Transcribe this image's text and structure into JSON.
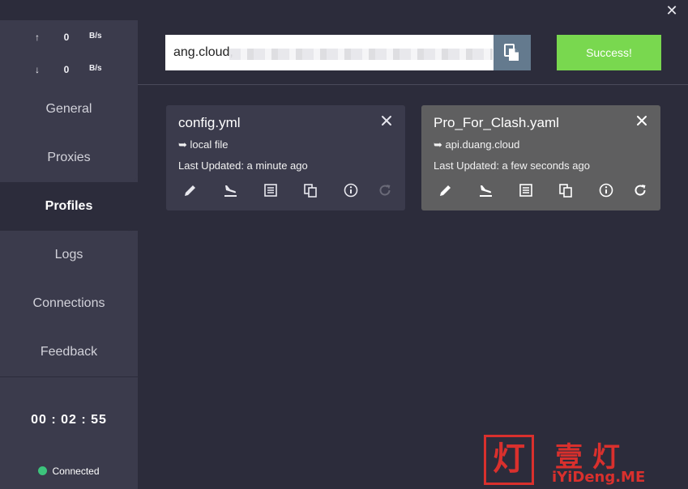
{
  "window": {
    "close_glyph": "✕"
  },
  "traffic": {
    "up": {
      "arrow": "↑",
      "value": "0",
      "unit": "B/s"
    },
    "down": {
      "arrow": "↓",
      "value": "0",
      "unit": "B/s"
    }
  },
  "nav": {
    "items": [
      {
        "label": "General"
      },
      {
        "label": "Proxies"
      },
      {
        "label": "Profiles"
      },
      {
        "label": "Logs"
      },
      {
        "label": "Connections"
      },
      {
        "label": "Feedback"
      }
    ],
    "active": "Profiles"
  },
  "timer": "00 : 02 : 55",
  "status": {
    "label": "Connected",
    "color": "#3cc47c"
  },
  "toolbar": {
    "url_value": "ang.cloud,",
    "success_label": "Success!",
    "success_color": "#79d84f",
    "paste_color": "#647a8e"
  },
  "profiles": [
    {
      "title": "config.yml",
      "source": "➥ local file",
      "updated": "Last Updated: a minute ago"
    },
    {
      "title": "Pro_For_Clash.yaml",
      "source": "➥ api.duang.cloud",
      "updated": "Last Updated: a few seconds ago"
    }
  ],
  "watermark": {
    "box_text": "灯",
    "cn_text": "壹灯",
    "en_text": "iYiDeng.ME",
    "color": "#d9302d"
  }
}
